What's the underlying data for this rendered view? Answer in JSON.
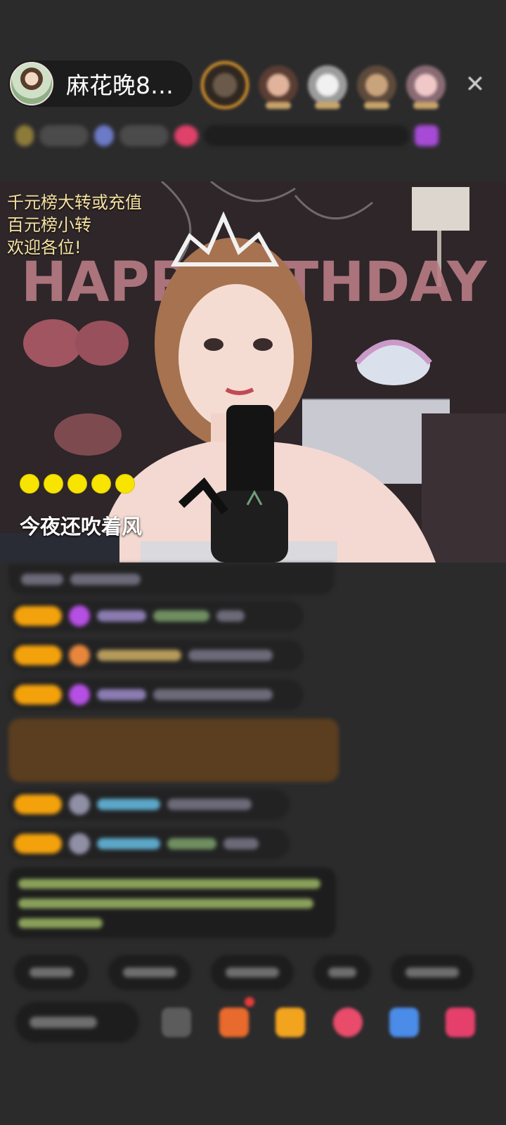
{
  "header": {
    "host_name": "麻花晚8…",
    "close_icon": "close-icon"
  },
  "video": {
    "overlay_lines": [
      "千元榜大转或充值",
      "百元榜小转",
      "欢迎各位!"
    ],
    "song_title": "今夜还吹着风",
    "decor_text": "HAPPY BIRTHDAY"
  },
  "colors": {
    "overlay_text": "#f7e3a0",
    "dots": "#f7e400",
    "level_badge": "#f4a20c",
    "background": "#2b2b2c"
  }
}
